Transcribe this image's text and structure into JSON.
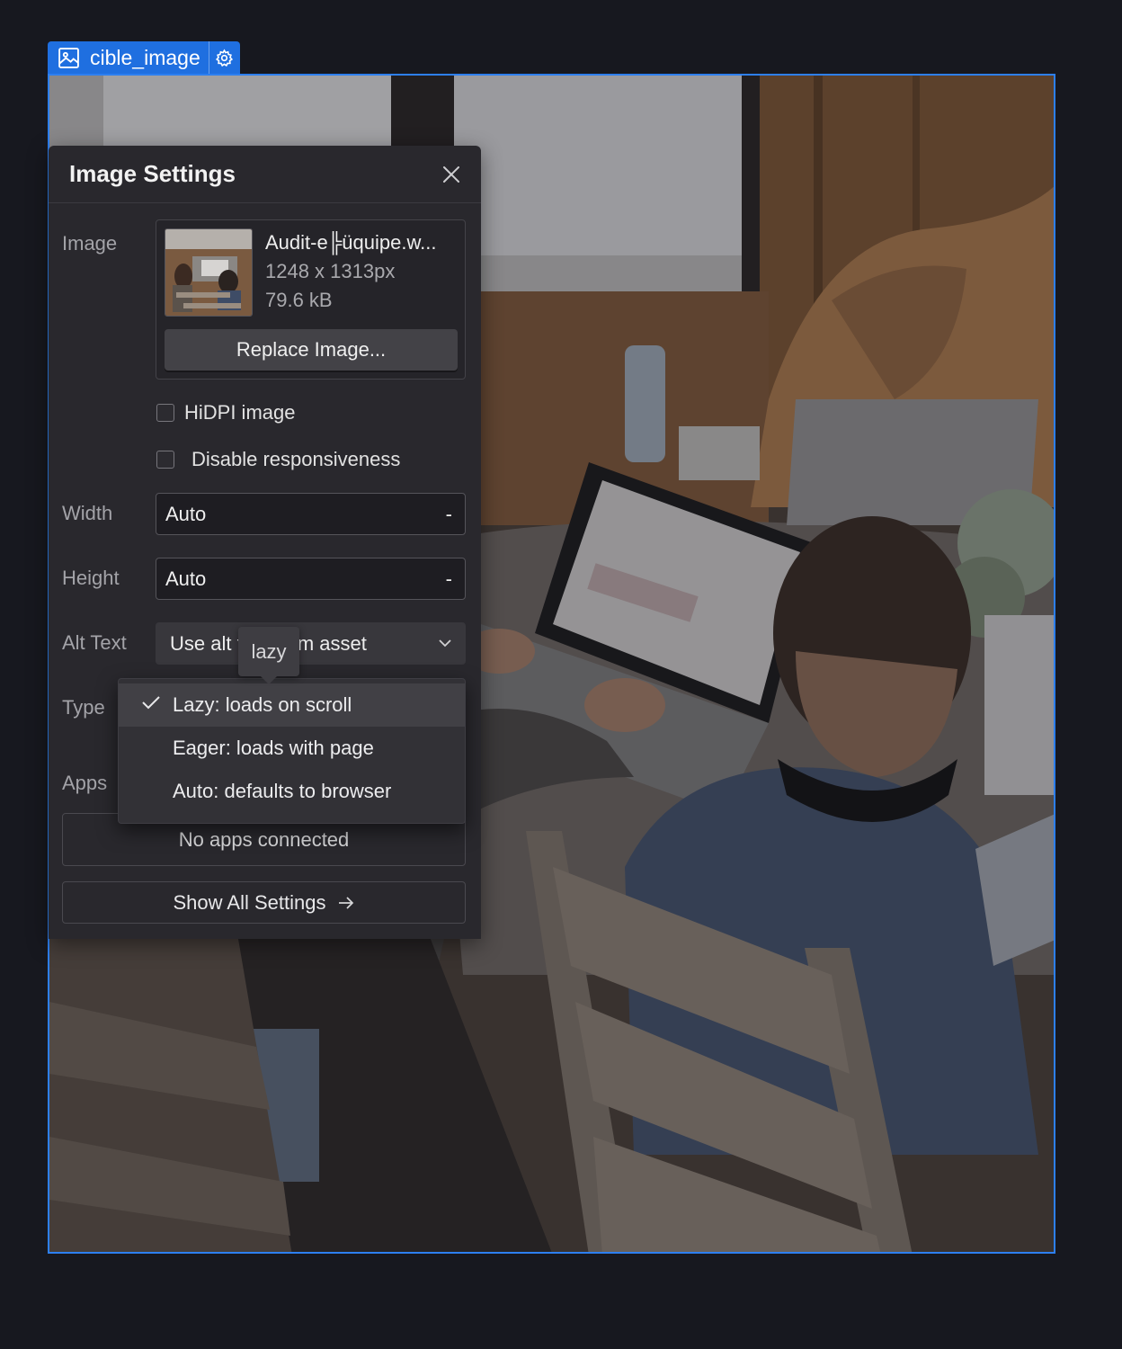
{
  "element_tag": {
    "name": "cible_image",
    "icon": "image-icon",
    "settings_icon": "gear-icon",
    "accent": "#1f6fe0"
  },
  "panel": {
    "title": "Image Settings",
    "close_icon": "close-icon",
    "image": {
      "label": "Image",
      "file_name": "Audit-e╠üquipe.w...",
      "dimensions": "1248 x 1313px",
      "file_size": "79.6 kB",
      "replace_label": "Replace Image..."
    },
    "hidpi_label": "HiDPI image",
    "disable_responsive_label": "Disable responsiveness",
    "width": {
      "label": "Width",
      "value": "Auto",
      "unit": "-"
    },
    "height": {
      "label": "Height",
      "value": "Auto",
      "unit": "-"
    },
    "alt_text": {
      "label": "Alt Text",
      "value": "Use alt text from asset"
    },
    "type": {
      "label": "Type",
      "options": [
        "Lazy: loads on scroll",
        "Eager: loads with page",
        "Auto: defaults to browser"
      ],
      "selected": "Lazy: loads on scroll",
      "tooltip": "lazy"
    },
    "apps": {
      "label": "Apps",
      "empty_text": "No apps connected"
    },
    "show_all_label": "Show All Settings"
  }
}
